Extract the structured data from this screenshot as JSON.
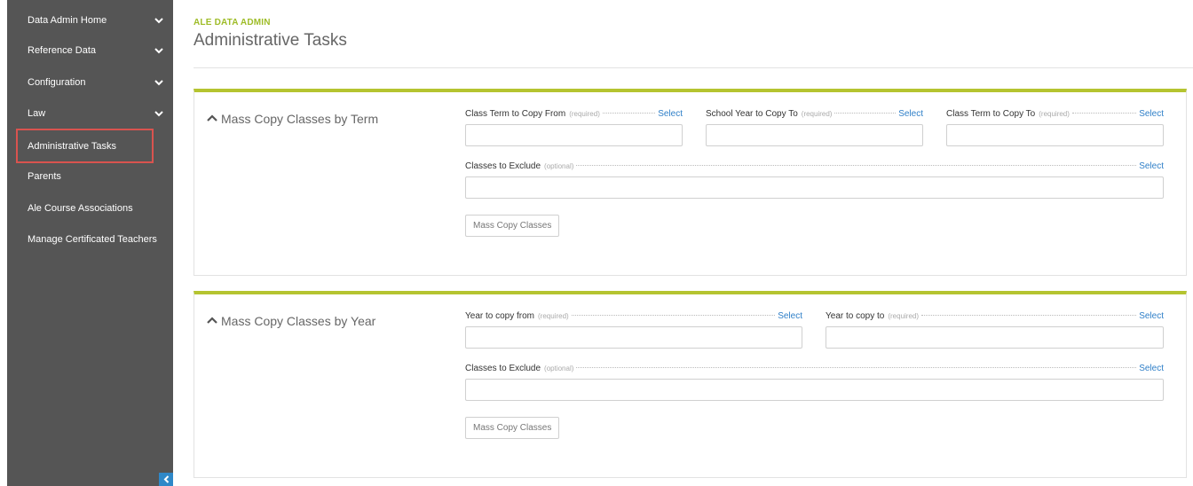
{
  "sidebar": {
    "items": [
      {
        "label": "Data Admin Home",
        "chevron": true
      },
      {
        "label": "Reference Data",
        "chevron": true
      },
      {
        "label": "Configuration",
        "chevron": true
      },
      {
        "label": "Law",
        "chevron": true
      },
      {
        "label": "Administrative Tasks",
        "chevron": false,
        "selected": true
      },
      {
        "label": "Parents",
        "chevron": false
      },
      {
        "label": "Ale Course Associations",
        "chevron": false
      },
      {
        "label": "Manage Certificated Teachers",
        "chevron": false
      }
    ],
    "collapse_icon": "chevron-left-icon"
  },
  "header": {
    "eyebrow": "ALE DATA ADMIN",
    "title": "Administrative Tasks"
  },
  "panels": [
    {
      "title": "Mass Copy Classes by Term",
      "fields": [
        {
          "label": "Class Term to Copy From",
          "hint": "(required)",
          "action": "Select",
          "value": ""
        },
        {
          "label": "School Year to Copy To",
          "hint": "(required)",
          "action": "Select",
          "value": ""
        },
        {
          "label": "Class Term to Copy To",
          "hint": "(required)",
          "action": "Select",
          "value": ""
        },
        {
          "label": "Classes to Exclude",
          "hint": "(optional)",
          "action": "Select",
          "value": ""
        }
      ],
      "button": "Mass Copy Classes"
    },
    {
      "title": "Mass Copy Classes by Year",
      "fields": [
        {
          "label": "Year to copy from",
          "hint": "(required)",
          "action": "Select",
          "value": ""
        },
        {
          "label": "Year to copy to",
          "hint": "(required)",
          "action": "Select",
          "value": ""
        },
        {
          "label": "Classes to Exclude",
          "hint": "(optional)",
          "action": "Select",
          "value": ""
        }
      ],
      "button": "Mass Copy Classes"
    }
  ],
  "colors": {
    "sidebar_bg": "#555555",
    "accent_green": "#b5c430",
    "eyebrow_green": "#9ebc27",
    "link_blue": "#2f7fc8",
    "selected_outline": "#d9534f"
  }
}
